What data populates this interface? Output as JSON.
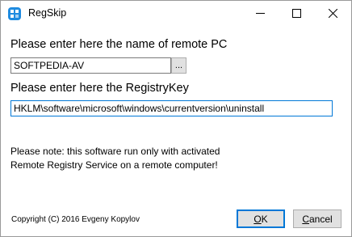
{
  "window": {
    "title": "RegSkip",
    "app_icon": "regskip-app-icon",
    "controls": {
      "minimize_icon": "minimize-icon",
      "maximize_icon": "maximize-icon",
      "close_icon": "close-icon"
    }
  },
  "form": {
    "pc_label": "Please enter here the name of remote PC",
    "pc_value": "SOFTPEDIA-AV",
    "browse_label": "...",
    "key_label": "Please enter here the RegistryKey",
    "key_value": "HKLM\\software\\microsoft\\windows\\currentversion\\uninstall"
  },
  "note": {
    "line1": "Please note: this software run only with activated",
    "line2": "Remote Registry Service on a remote computer!"
  },
  "footer": {
    "copyright": "Copyright (C) 2016 Evgeny Kopylov",
    "ok_accel": "O",
    "ok_rest": "K",
    "cancel_accel": "C",
    "cancel_rest": "ancel"
  },
  "colors": {
    "accent": "#0078d7",
    "app_icon": "#1f8be0",
    "button_face": "#e1e1e1"
  }
}
